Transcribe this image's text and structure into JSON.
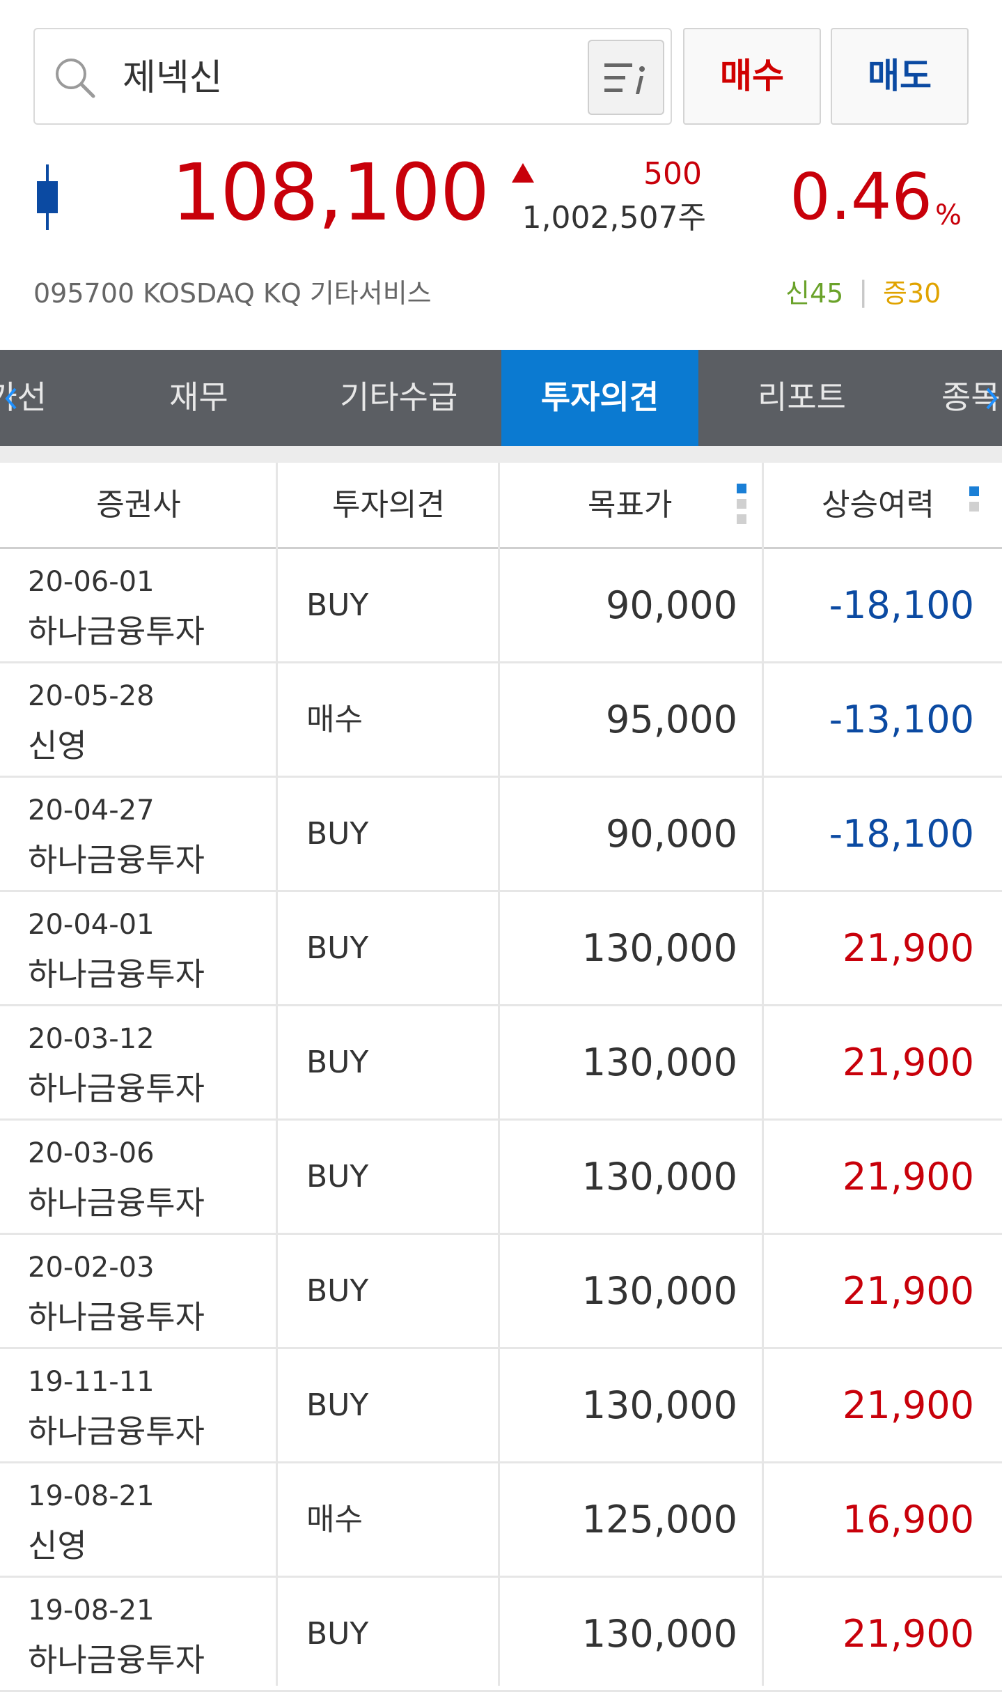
{
  "search": {
    "query": "제넥신"
  },
  "buttons": {
    "buy": "매수",
    "sell": "매도"
  },
  "colors": {
    "up": "#c8000a",
    "down": "#0b4aa2",
    "tab_active": "#0b7ad1",
    "tabbar": "#5b5e63"
  },
  "quote": {
    "price": "108,100",
    "change": "500",
    "volume": "1,002,507주",
    "change_pct": "0.46",
    "pct_sign": "%",
    "info": "095700  KOSDAQ  KQ 기타서비스",
    "badge_new": "신45",
    "badge_sep": "|",
    "badge_margin": "증30"
  },
  "tabs": [
    {
      "label": "호가선",
      "active": false
    },
    {
      "label": "재무",
      "active": false
    },
    {
      "label": "기타수급",
      "active": false
    },
    {
      "label": "투자의견",
      "active": true
    },
    {
      "label": "리포트",
      "active": false
    },
    {
      "label": "종목",
      "active": false
    }
  ],
  "table": {
    "headers": [
      "증권사",
      "투자의견",
      "목표가",
      "상승여력"
    ],
    "rows": [
      {
        "date": "20-06-01",
        "firm": "하나금융투자",
        "opinion": "BUY",
        "target": "90,000",
        "upside": "-18,100",
        "direction": "down"
      },
      {
        "date": "20-05-28",
        "firm": "신영",
        "opinion": "매수",
        "target": "95,000",
        "upside": "-13,100",
        "direction": "down"
      },
      {
        "date": "20-04-27",
        "firm": "하나금융투자",
        "opinion": "BUY",
        "target": "90,000",
        "upside": "-18,100",
        "direction": "down"
      },
      {
        "date": "20-04-01",
        "firm": "하나금융투자",
        "opinion": "BUY",
        "target": "130,000",
        "upside": "21,900",
        "direction": "up"
      },
      {
        "date": "20-03-12",
        "firm": "하나금융투자",
        "opinion": "BUY",
        "target": "130,000",
        "upside": "21,900",
        "direction": "up"
      },
      {
        "date": "20-03-06",
        "firm": "하나금융투자",
        "opinion": "BUY",
        "target": "130,000",
        "upside": "21,900",
        "direction": "up"
      },
      {
        "date": "20-02-03",
        "firm": "하나금융투자",
        "opinion": "BUY",
        "target": "130,000",
        "upside": "21,900",
        "direction": "up"
      },
      {
        "date": "19-11-11",
        "firm": "하나금융투자",
        "opinion": "BUY",
        "target": "130,000",
        "upside": "21,900",
        "direction": "up"
      },
      {
        "date": "19-08-21",
        "firm": "신영",
        "opinion": "매수",
        "target": "125,000",
        "upside": "16,900",
        "direction": "up"
      },
      {
        "date": "19-08-21",
        "firm": "하나금융투자",
        "opinion": "BUY",
        "target": "130,000",
        "upside": "21,900",
        "direction": "up"
      }
    ]
  }
}
